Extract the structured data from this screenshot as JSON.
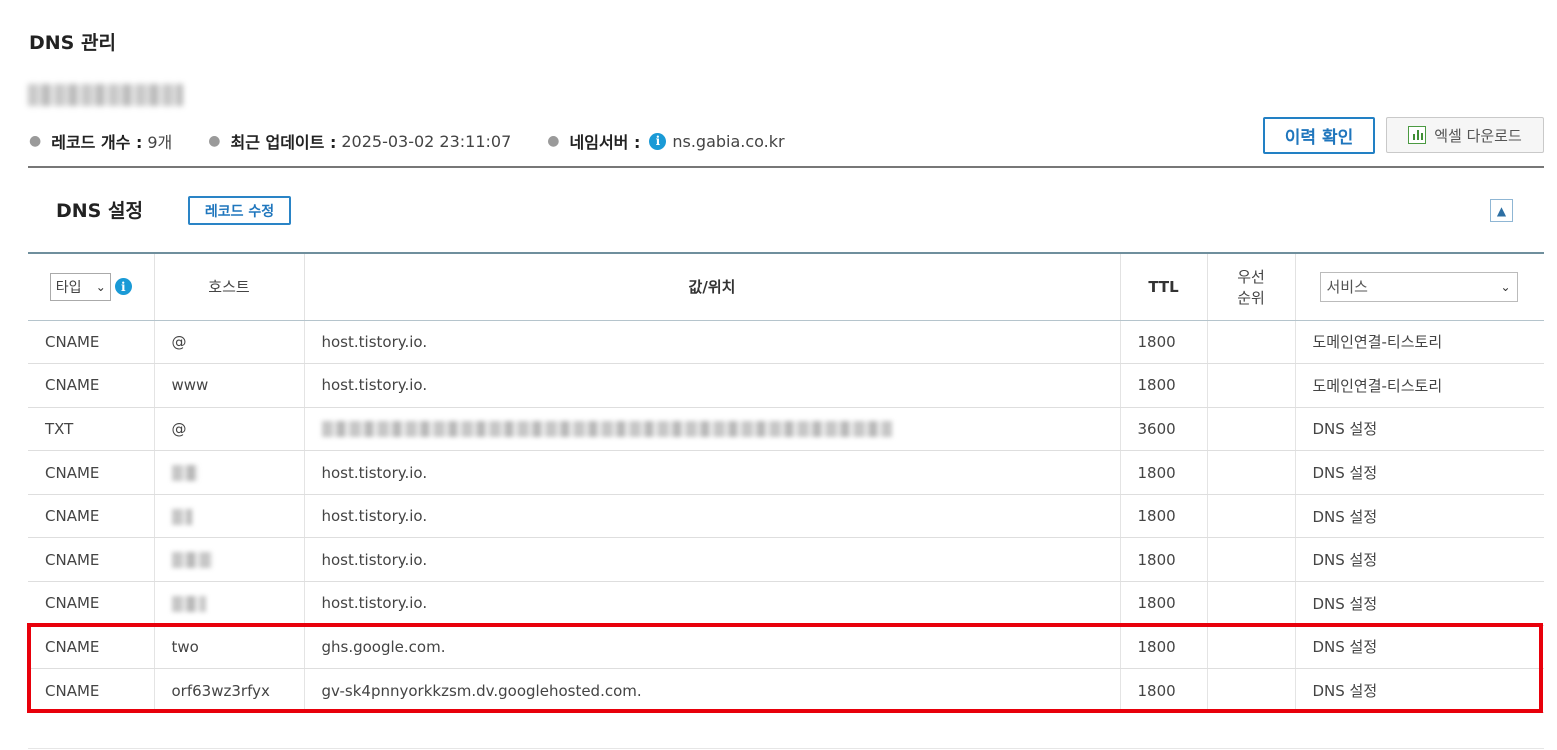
{
  "page": {
    "title": "DNS 관리"
  },
  "summary": {
    "record_count_label": "레코드 개수 :",
    "record_count_value": "9개",
    "last_update_label": "최근 업데이트 :",
    "last_update_value": "2025-03-02 23:11:07",
    "nameserver_label": "네임서버 :",
    "nameserver_value": "ns.gabia.co.kr",
    "info_icon": "info-icon"
  },
  "actions": {
    "history_label": "이력 확인",
    "excel_label": "엑셀 다운로드",
    "excel_icon": "excel-chart-icon"
  },
  "section": {
    "title": "DNS 설정",
    "edit_label": "레코드 수정",
    "collapse_icon": "chevron-up-icon"
  },
  "table": {
    "type_filter": "타입",
    "host_header": "호스트",
    "value_header": "값/위치",
    "ttl_header": "TTL",
    "priority_header_line1": "우선",
    "priority_header_line2": "순위",
    "service_filter": "서비스",
    "rows": [
      {
        "type": "CNAME",
        "host": "@",
        "value": "host.tistory.io.",
        "ttl": "1800",
        "priority": "",
        "service": "도메인연결-티스토리"
      },
      {
        "type": "CNAME",
        "host": "www",
        "value": "host.tistory.io.",
        "ttl": "1800",
        "priority": "",
        "service": "도메인연결-티스토리"
      },
      {
        "type": "TXT",
        "host": "@",
        "value": "",
        "ttl": "3600",
        "priority": "",
        "service": "DNS 설정"
      },
      {
        "type": "CNAME",
        "host": "",
        "value": "host.tistory.io.",
        "ttl": "1800",
        "priority": "",
        "service": "DNS 설정"
      },
      {
        "type": "CNAME",
        "host": "",
        "value": "host.tistory.io.",
        "ttl": "1800",
        "priority": "",
        "service": "DNS 설정"
      },
      {
        "type": "CNAME",
        "host": "",
        "value": "host.tistory.io.",
        "ttl": "1800",
        "priority": "",
        "service": "DNS 설정"
      },
      {
        "type": "CNAME",
        "host": "",
        "value": "host.tistory.io.",
        "ttl": "1800",
        "priority": "",
        "service": "DNS 설정"
      },
      {
        "type": "CNAME",
        "host": "two",
        "value": "ghs.google.com.",
        "ttl": "1800",
        "priority": "",
        "service": "DNS 설정"
      },
      {
        "type": "CNAME",
        "host": "orf63wz3rfyx",
        "value": "gv-sk4pnnyorkkzsm.dv.googlehosted.com.",
        "ttl": "1800",
        "priority": "",
        "service": "DNS 설정"
      }
    ]
  },
  "colors": {
    "accent_blue": "#1f76bd",
    "highlight_red": "#e8000b",
    "info_blue": "#1a9ad6"
  }
}
